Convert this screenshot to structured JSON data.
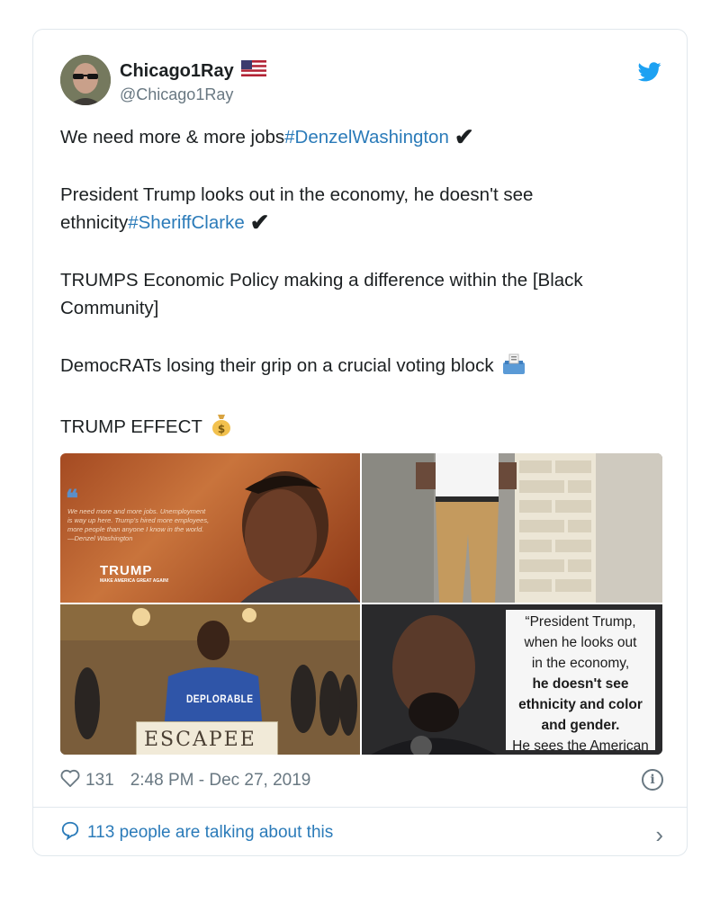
{
  "tweet": {
    "display_name": "Chicago1Ray",
    "handle": "@Chicago1Ray",
    "flag_icon": "us-flag-icon",
    "brand_icon": "twitter-bird-icon",
    "paragraphs": [
      {
        "text": "We need more & more jobs",
        "hashtag": "#DenzelWashington",
        "suffix": "✔"
      },
      {
        "text": "President Trump looks out in the economy, he doesn't see ethnicity",
        "hashtag": "#SheriffClarke",
        "suffix": "✔"
      },
      {
        "text": "TRUMPS Economic Policy making a difference within the [Black Community]"
      },
      {
        "text": "DemocRATs losing their grip on a crucial voting block",
        "emoji": "ballot-box-icon"
      },
      {
        "text": "TRUMP EFFECT",
        "emoji": "money-bag-icon"
      }
    ],
    "media": {
      "denzel_quote": "We need more and more jobs. Unemployment is way up here. Trump's hired more employees, more people than anyone I know in the world. —Denzel Washington",
      "trump_logo": "TRUMP",
      "trump_slogan": "MAKE AMERICA GREAT AGAIN!",
      "shirt_text": "DEPLORABLE",
      "sign_text": "ESCAPEE",
      "clarke_quote_lines": [
        "“President Trump,",
        "when he looks out",
        "in the economy,",
        "he doesn't see",
        "ethnicity and color",
        "and gender.",
        "He sees the American"
      ]
    },
    "likes": "131",
    "timestamp": "2:48 PM - Dec 27, 2019",
    "talking": "113 people are talking about this",
    "colors": {
      "link": "#2b7bb9",
      "meta": "#697882",
      "border": "#e1e8ed"
    }
  }
}
